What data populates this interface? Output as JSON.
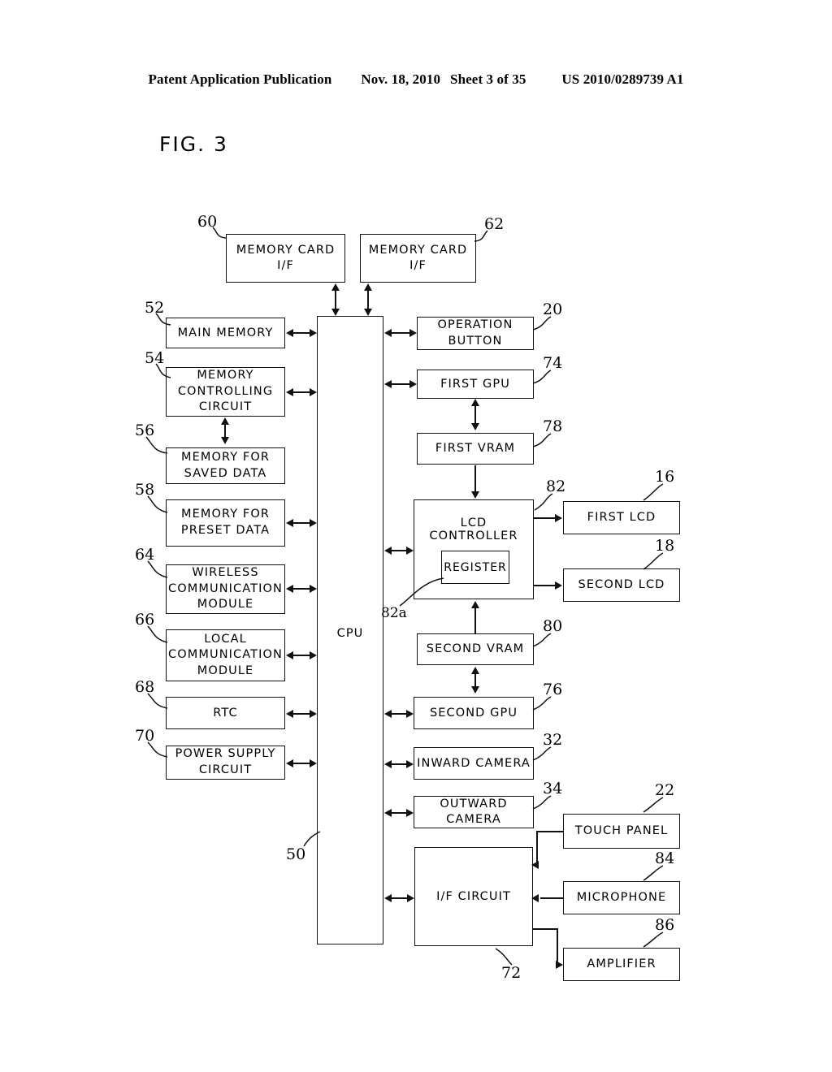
{
  "header": {
    "publication": "Patent Application Publication",
    "date": "Nov. 18, 2010",
    "sheet": "Sheet 3 of 35",
    "docnum": "US 2010/0289739 A1"
  },
  "figure": {
    "title": "FIG. 3"
  },
  "blocks": {
    "memory_card_if_1": {
      "label": "MEMORY CARD I/F",
      "ref": "60"
    },
    "memory_card_if_2": {
      "label": "MEMORY CARD I/F",
      "ref": "62"
    },
    "main_memory": {
      "label": "MAIN MEMORY",
      "ref": "52"
    },
    "memory_controlling_circuit": {
      "label": "MEMORY\nCONTROLLING\nCIRCUIT",
      "ref": "54"
    },
    "memory_for_saved_data": {
      "label": "MEMORY FOR\nSAVED DATA",
      "ref": "56"
    },
    "memory_for_preset_data": {
      "label": "MEMORY FOR\nPRESET DATA",
      "ref": "58"
    },
    "wireless_communication_module": {
      "label": "WIRELESS\nCOMMUNICATION\nMODULE",
      "ref": "64"
    },
    "local_communication_module": {
      "label": "LOCAL\nCOMMUNICATION\nMODULE",
      "ref": "66"
    },
    "rtc": {
      "label": "RTC",
      "ref": "68"
    },
    "power_supply_circuit": {
      "label": "POWER SUPPLY\nCIRCUIT",
      "ref": "70"
    },
    "cpu": {
      "label": "CPU",
      "ref": "50"
    },
    "operation_button": {
      "label": "OPERATION\nBUTTON",
      "ref": "20"
    },
    "first_gpu": {
      "label": "FIRST GPU",
      "ref": "74"
    },
    "first_vram": {
      "label": "FIRST VRAM",
      "ref": "78"
    },
    "lcd_controller": {
      "label": "LCD CONTROLLER",
      "ref": "82"
    },
    "register": {
      "label": "REGISTER",
      "ref": "82a"
    },
    "first_lcd": {
      "label": "FIRST LCD",
      "ref": "16"
    },
    "second_lcd": {
      "label": "SECOND LCD",
      "ref": "18"
    },
    "second_vram": {
      "label": "SECOND VRAM",
      "ref": "80"
    },
    "second_gpu": {
      "label": "SECOND GPU",
      "ref": "76"
    },
    "inward_camera": {
      "label": "INWARD CAMERA",
      "ref": "32"
    },
    "outward_camera": {
      "label": "OUTWARD CAMERA",
      "ref": "34"
    },
    "if_circuit": {
      "label": "I/F CIRCUIT",
      "ref": "72"
    },
    "touch_panel": {
      "label": "TOUCH PANEL",
      "ref": "22"
    },
    "microphone": {
      "label": "MICROPHONE",
      "ref": "84"
    },
    "amplifier": {
      "label": "AMPLIFIER",
      "ref": "86"
    }
  }
}
